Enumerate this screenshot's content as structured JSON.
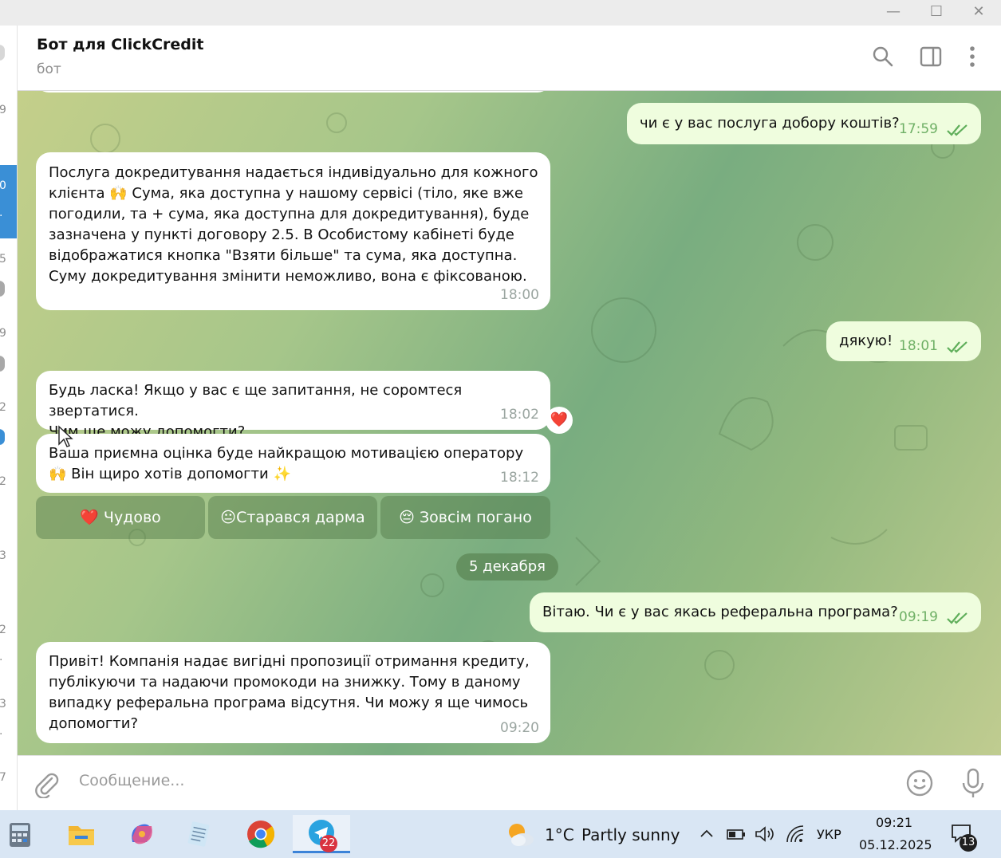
{
  "window": {
    "controls": [
      "minimize",
      "maximize",
      "close"
    ]
  },
  "sidebar_partial": {
    "fragments": [
      "9",
      "0",
      ".",
      "5",
      "9",
      "2",
      "2",
      "3",
      "2",
      ".",
      "3",
      ".",
      "7"
    ]
  },
  "header": {
    "title": "Бот для ClickCredit",
    "subtitle": "бот",
    "icons": [
      "search-icon",
      "columns-icon",
      "more-vert-icon"
    ]
  },
  "messages": [
    {
      "dir": "out",
      "text": "чи є у вас послуга добору коштів?",
      "time": "17:59",
      "status": "read"
    },
    {
      "dir": "in",
      "text": "Послуга докредитування надається індивідуально для кожного\nклієнта 🙌 Сума, яка доступна у нашому сервісі (тіло, яке вже\nпогодили, та + сума, яка доступна для докредитування), буде\nзазначена у пункті договору 2.5. В Особистому кабінеті буде\nвідображатися кнопка \"Взяти більше\" та сума, яка доступна.\nСуму докредитування змінити неможливо, вона є фіксованою.",
      "time": "18:00"
    },
    {
      "dir": "out",
      "text": "дякую!",
      "time": "18:01",
      "status": "read"
    },
    {
      "dir": "in",
      "text": "Будь ласка! Якщо у вас є ще запитання, не соромтеся звертатися.\nЧим ще можу допомогти?",
      "time": "18:02",
      "reaction": "❤️"
    },
    {
      "dir": "in",
      "text": "Ваша приємна оцінка буде найкращою мотивацією  оператору\n🙌 Він щиро хотів допомогти ✨",
      "time": "18:12"
    },
    {
      "dir": "out",
      "text": "Вітаю. Чи є у вас якась реферальна програма?",
      "time": "09:19",
      "status": "read"
    },
    {
      "dir": "in",
      "text": "Привіт! Компанія надає вигідні пропозиції отримання кредиту,\nпублікуючи та надаючи промокоди на знижку. Тому в даному\nвипадку реферальна програма відсутня. Чи можу я ще чимось\nдопомогти?",
      "time": "09:20"
    }
  ],
  "rating_buttons": [
    "❤️ Чудово",
    "😐Старався дарма",
    "😔 Зовсім погано"
  ],
  "date_separator": "5 декабря",
  "composer": {
    "placeholder": "Сообщение...",
    "icons": [
      "attach-icon",
      "emoji-icon",
      "microphone-icon"
    ]
  },
  "taskbar": {
    "apps": [
      {
        "name": "calculator"
      },
      {
        "name": "file-explorer"
      },
      {
        "name": "copilot"
      },
      {
        "name": "notepad"
      },
      {
        "name": "chrome"
      },
      {
        "name": "telegram",
        "badge": "22",
        "active": true
      }
    ],
    "weather": {
      "temp": "1°C",
      "desc": "Partly sunny"
    },
    "language": "УКР",
    "time": "09:21",
    "date": "05.12.2025",
    "notifications": "13"
  },
  "colors": {
    "incoming_bubble": "#ffffff",
    "outgoing_bubble": "#effdde",
    "read_checks": "#5fae5a",
    "heart": "#e0245e",
    "badge": "#d9333f"
  }
}
